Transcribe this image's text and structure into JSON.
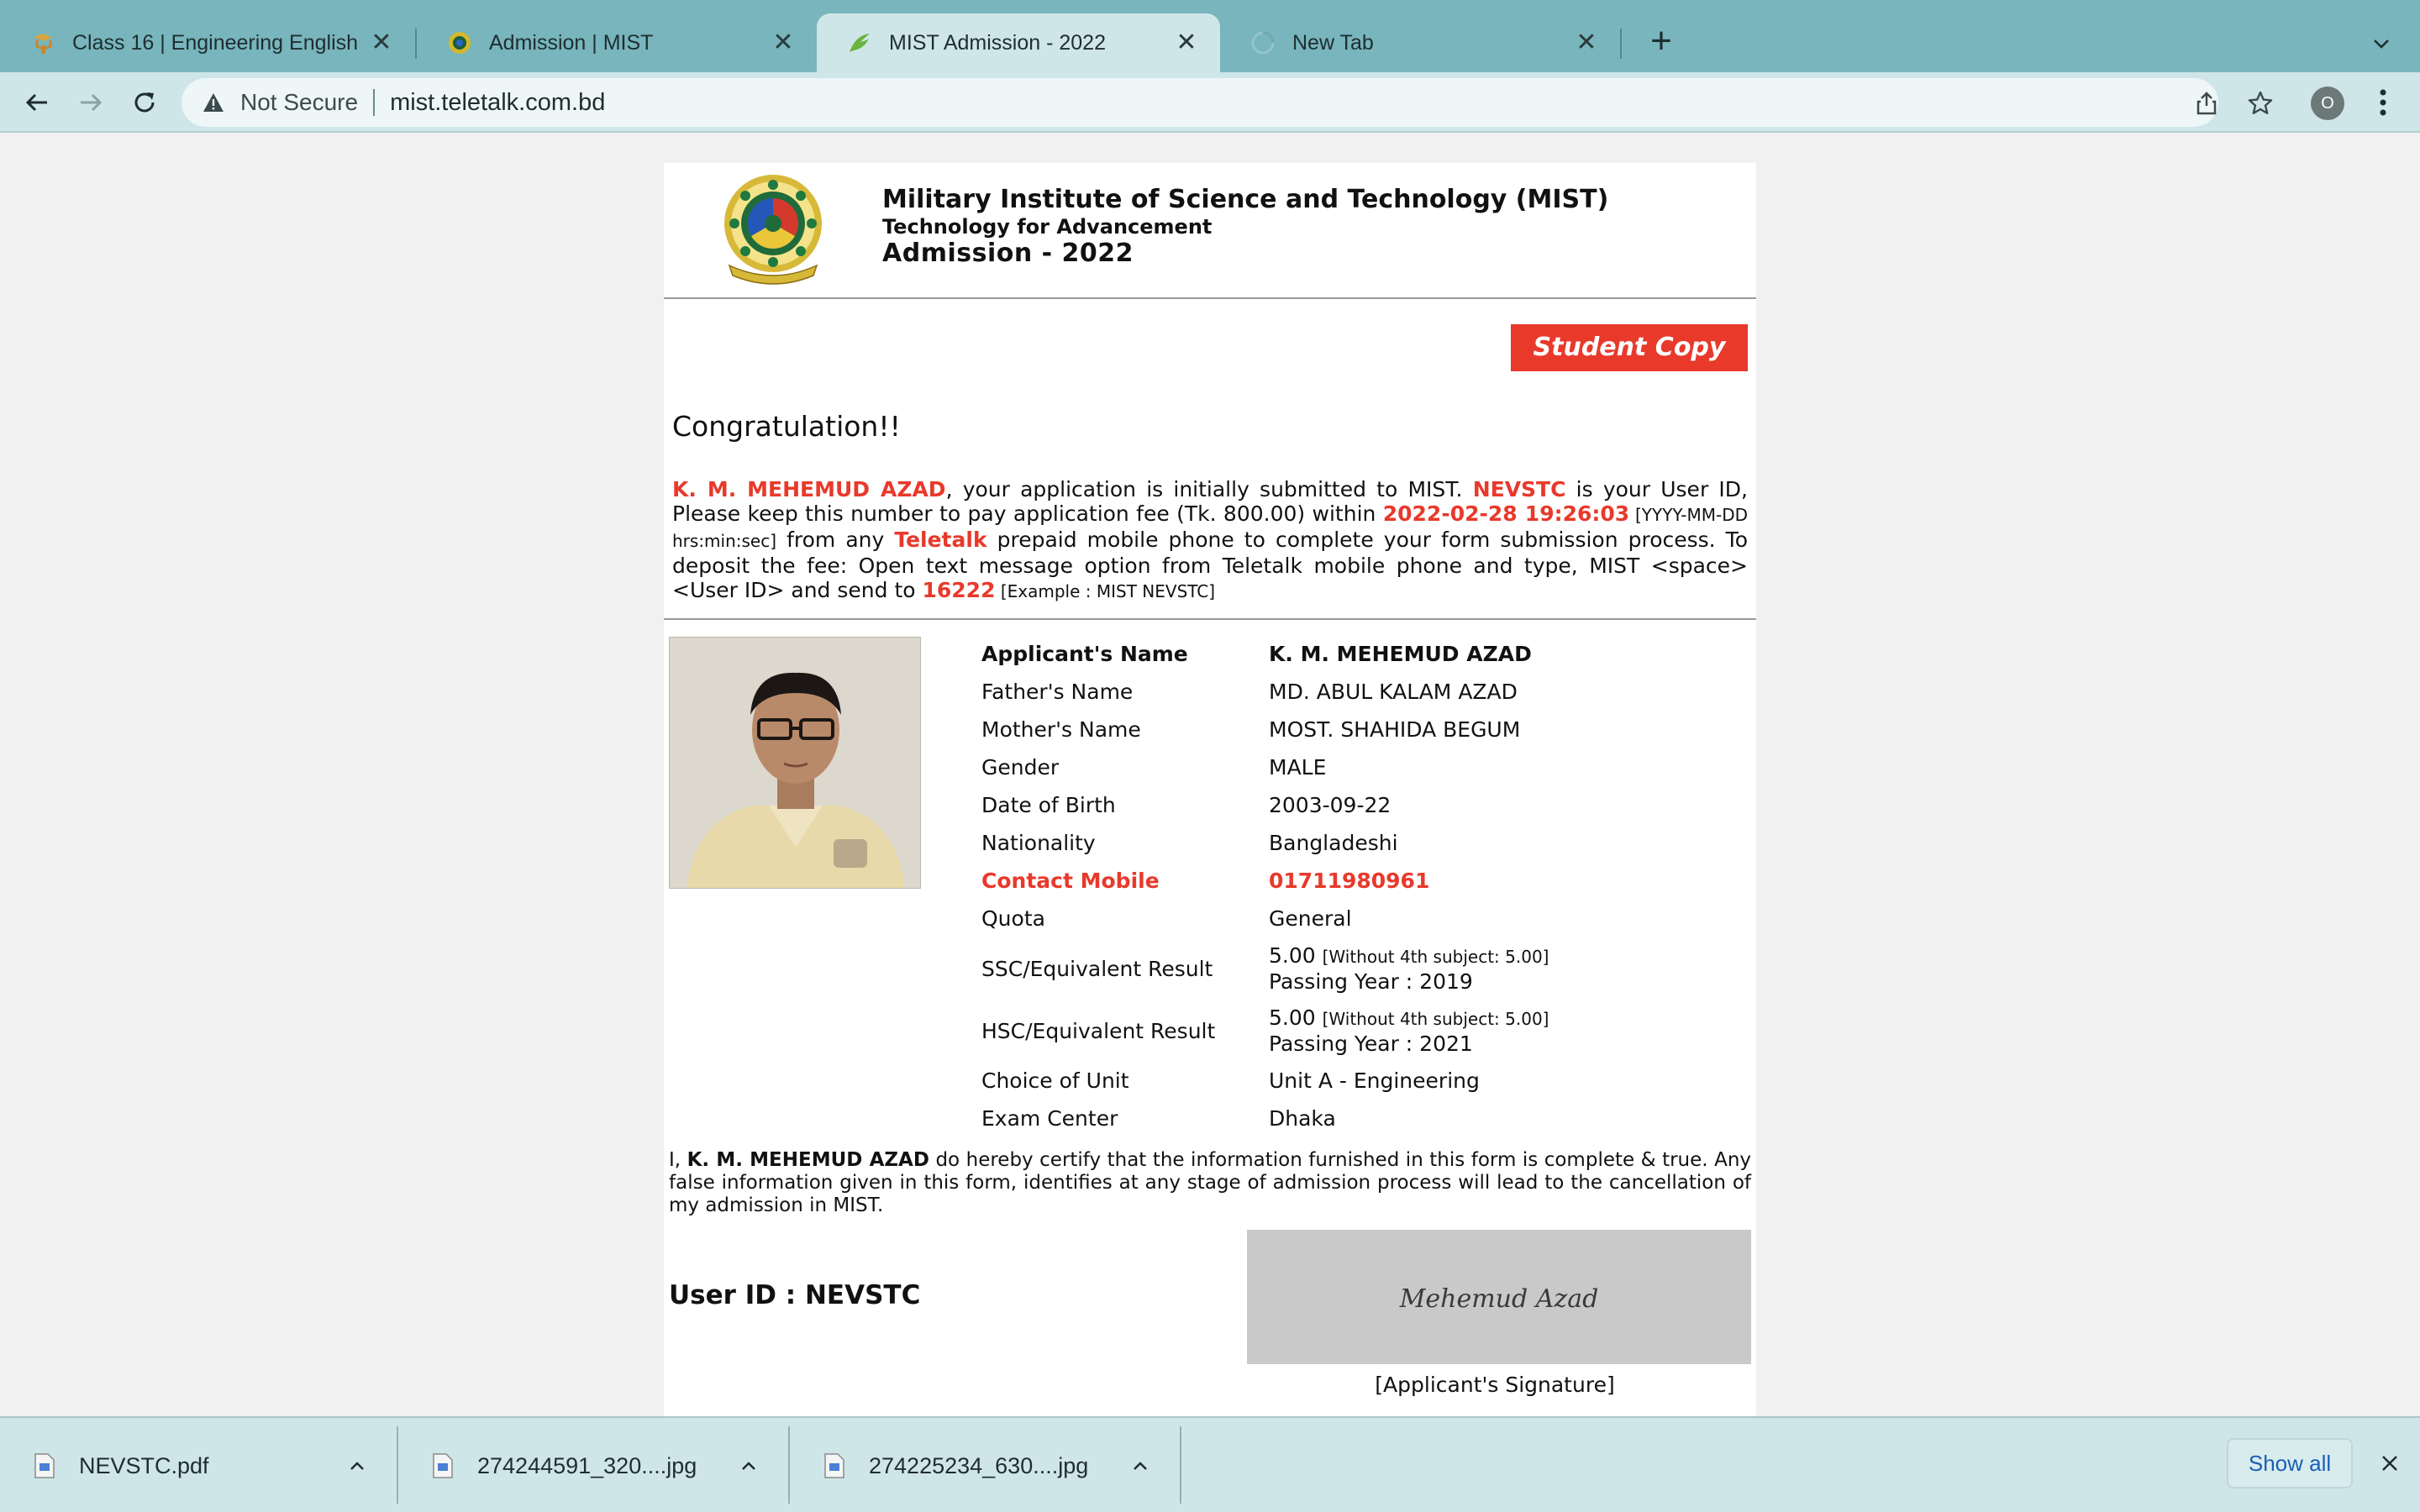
{
  "browser": {
    "tabs": [
      {
        "title": "Class 16 | Engineering English",
        "active": false
      },
      {
        "title": "Admission | MIST",
        "active": false
      },
      {
        "title": "MIST Admission - 2022",
        "active": true
      },
      {
        "title": "New Tab",
        "active": false,
        "loading": true
      }
    ],
    "close_glyph": "✕",
    "new_tab_glyph": "+",
    "security_label": "Not Secure",
    "url": "mist.teletalk.com.bd",
    "profile_initial": "O"
  },
  "header": {
    "title": "Military Institute of Science and Technology (MIST)",
    "subtitle": "Technology for Advancement",
    "admission": "Admission - 2022"
  },
  "student_copy_label": "Student Copy",
  "congrats": "Congratulation!!",
  "message": {
    "name": "K. M. MEHEMUD AZAD",
    "t1": ", your application is initially submitted to MIST. ",
    "user_id": "NEVSTC",
    "t2": " is your User ID, Please keep this number to pay application fee (Tk. 800.00) within ",
    "deadline": "2022-02-28 19:26:03",
    "format_hint": " [YYYY-MM-DD hrs:min:sec]",
    "t3": " from any ",
    "operator": "Teletalk",
    "t4": " prepaid mobile phone to complete your form submission process. To deposit the fee: Open text message option from Teletalk mobile phone and type, MIST <space> <User ID> and send to ",
    "sms_number": "16222",
    "example": " [Example : MIST NEVSTC]"
  },
  "applicant": {
    "rows": [
      {
        "label": "Applicant's Name",
        "value": "K. M. MEHEMUD AZAD"
      },
      {
        "label": "Father's Name",
        "value": "MD. ABUL KALAM AZAD"
      },
      {
        "label": "Mother's Name",
        "value": "MOST. SHAHIDA BEGUM"
      },
      {
        "label": "Gender",
        "value": "MALE"
      },
      {
        "label": "Date of Birth",
        "value": "2003-09-22"
      },
      {
        "label": "Nationality",
        "value": "Bangladeshi"
      },
      {
        "label": "Contact Mobile",
        "value": "01711980961"
      },
      {
        "label": "Quota",
        "value": "General"
      },
      {
        "label": "SSC/Equivalent Result",
        "value": "5.00",
        "note": "[Without 4th subject: 5.00]",
        "line2": "Passing Year : 2019"
      },
      {
        "label": "HSC/Equivalent Result",
        "value": "5.00",
        "note": "[Without 4th subject: 5.00]",
        "line2": "Passing Year : 2021"
      },
      {
        "label": "Choice of Unit",
        "value": "Unit A - Engineering"
      },
      {
        "label": "Exam Center",
        "value": "Dhaka"
      }
    ]
  },
  "certify": {
    "prefix": "I, ",
    "name": "K. M. MEHEMUD AZAD",
    "text": " do hereby certify that the information furnished in this form is complete & true. Any false information given in this form, identifies at any stage of admission process will lead to the cancellation of my admission in MIST."
  },
  "user_id_label": "User ID : NEVSTC",
  "signature_text": "Mehemud Azad",
  "signature_caption": "[Applicant's Signature]",
  "downloads": {
    "items": [
      {
        "name": "NEVSTC.pdf"
      },
      {
        "name": "274244591_320....jpg"
      },
      {
        "name": "274225234_630....jpg"
      }
    ],
    "show_all": "Show all"
  },
  "colors": {
    "accent_red": "#e8392b",
    "tabstrip": "#78b5bd",
    "toolbar": "#cfe6e9",
    "link_blue": "#1a5fb4"
  }
}
